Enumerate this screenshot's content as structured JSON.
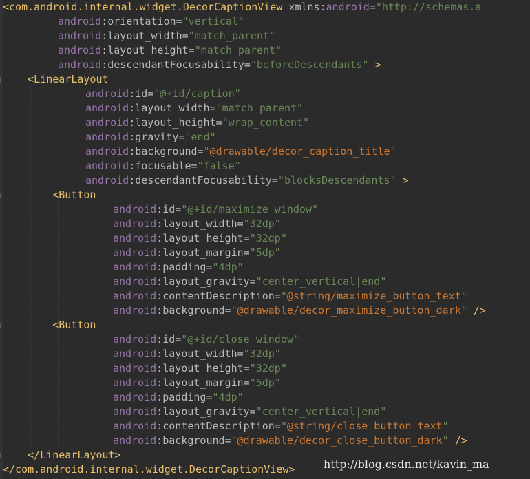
{
  "code_lines": [
    {
      "indent": 0,
      "parts": [
        {
          "t": "<com.android.internal.widget.DecorCaptionView",
          "c": "tag"
        },
        {
          "t": " ",
          "c": "plain"
        },
        {
          "t": "xmlns",
          "c": "attr"
        },
        {
          "t": ":",
          "c": "plain"
        },
        {
          "t": "android",
          "c": "ns"
        },
        {
          "t": "=",
          "c": "plain"
        },
        {
          "t": "\"http://schemas.a",
          "c": "str"
        }
      ]
    },
    {
      "indent": 1,
      "parts": [
        {
          "t": "android",
          "c": "ns"
        },
        {
          "t": ":orientation=",
          "c": "attr"
        },
        {
          "t": "\"vertical\"",
          "c": "str"
        }
      ]
    },
    {
      "indent": 1,
      "parts": [
        {
          "t": "android",
          "c": "ns"
        },
        {
          "t": ":layout_width=",
          "c": "attr"
        },
        {
          "t": "\"match_parent\"",
          "c": "str"
        }
      ]
    },
    {
      "indent": 1,
      "parts": [
        {
          "t": "android",
          "c": "ns"
        },
        {
          "t": ":layout_height=",
          "c": "attr"
        },
        {
          "t": "\"match_parent\"",
          "c": "str"
        }
      ]
    },
    {
      "indent": 1,
      "parts": [
        {
          "t": "android",
          "c": "ns"
        },
        {
          "t": ":descendantFocusability=",
          "c": "attr"
        },
        {
          "t": "\"beforeDescendants\"",
          "c": "str"
        },
        {
          "t": " >",
          "c": "tag"
        }
      ]
    },
    {
      "indent": 0,
      "parts": [
        {
          "t": "    <LinearLayout",
          "c": "tag"
        }
      ]
    },
    {
      "indent": 2,
      "parts": [
        {
          "t": "android",
          "c": "ns"
        },
        {
          "t": ":id=",
          "c": "attr"
        },
        {
          "t": "\"@+id/caption\"",
          "c": "str"
        }
      ]
    },
    {
      "indent": 2,
      "parts": [
        {
          "t": "android",
          "c": "ns"
        },
        {
          "t": ":layout_width=",
          "c": "attr"
        },
        {
          "t": "\"match_parent\"",
          "c": "str"
        }
      ]
    },
    {
      "indent": 2,
      "parts": [
        {
          "t": "android",
          "c": "ns"
        },
        {
          "t": ":layout_height=",
          "c": "attr"
        },
        {
          "t": "\"wrap_content\"",
          "c": "str"
        }
      ]
    },
    {
      "indent": 2,
      "parts": [
        {
          "t": "android",
          "c": "ns"
        },
        {
          "t": ":gravity=",
          "c": "attr"
        },
        {
          "t": "\"end\"",
          "c": "str"
        }
      ]
    },
    {
      "indent": 2,
      "parts": [
        {
          "t": "android",
          "c": "ns"
        },
        {
          "t": ":background=",
          "c": "attr"
        },
        {
          "t": "\"",
          "c": "str"
        },
        {
          "t": "@drawable/decor_caption_title",
          "c": "res"
        },
        {
          "t": "\"",
          "c": "str"
        }
      ]
    },
    {
      "indent": 2,
      "parts": [
        {
          "t": "android",
          "c": "ns"
        },
        {
          "t": ":focusable=",
          "c": "attr"
        },
        {
          "t": "\"false\"",
          "c": "str"
        }
      ]
    },
    {
      "indent": 2,
      "parts": [
        {
          "t": "android",
          "c": "ns"
        },
        {
          "t": ":descendantFocusability=",
          "c": "attr"
        },
        {
          "t": "\"blocksDescendants\"",
          "c": "str"
        },
        {
          "t": " >",
          "c": "tag"
        }
      ]
    },
    {
      "indent": 0,
      "parts": [
        {
          "t": "        <Button",
          "c": "tag"
        }
      ]
    },
    {
      "indent": 3,
      "parts": [
        {
          "t": "android",
          "c": "ns"
        },
        {
          "t": ":id=",
          "c": "attr"
        },
        {
          "t": "\"@+id/maximize_window\"",
          "c": "str"
        }
      ]
    },
    {
      "indent": 3,
      "parts": [
        {
          "t": "android",
          "c": "ns"
        },
        {
          "t": ":layout_width=",
          "c": "attr"
        },
        {
          "t": "\"32dp\"",
          "c": "str"
        }
      ]
    },
    {
      "indent": 3,
      "parts": [
        {
          "t": "android",
          "c": "ns"
        },
        {
          "t": ":layout_height=",
          "c": "attr"
        },
        {
          "t": "\"32dp\"",
          "c": "str"
        }
      ]
    },
    {
      "indent": 3,
      "parts": [
        {
          "t": "android",
          "c": "ns"
        },
        {
          "t": ":layout_margin=",
          "c": "attr"
        },
        {
          "t": "\"5dp\"",
          "c": "str"
        }
      ]
    },
    {
      "indent": 3,
      "parts": [
        {
          "t": "android",
          "c": "ns"
        },
        {
          "t": ":padding=",
          "c": "attr"
        },
        {
          "t": "\"4dp\"",
          "c": "str"
        }
      ]
    },
    {
      "indent": 3,
      "parts": [
        {
          "t": "android",
          "c": "ns"
        },
        {
          "t": ":layout_gravity=",
          "c": "attr"
        },
        {
          "t": "\"center_vertical|end\"",
          "c": "str"
        }
      ]
    },
    {
      "indent": 3,
      "parts": [
        {
          "t": "android",
          "c": "ns"
        },
        {
          "t": ":contentDescription=",
          "c": "attr"
        },
        {
          "t": "\"",
          "c": "str"
        },
        {
          "t": "@string/maximize_button_text",
          "c": "res"
        },
        {
          "t": "\"",
          "c": "str"
        }
      ]
    },
    {
      "indent": 3,
      "parts": [
        {
          "t": "android",
          "c": "ns"
        },
        {
          "t": ":background=",
          "c": "attr"
        },
        {
          "t": "\"",
          "c": "str"
        },
        {
          "t": "@drawable/decor_maximize_button_dark",
          "c": "res"
        },
        {
          "t": "\"",
          "c": "str"
        },
        {
          "t": " />",
          "c": "tag"
        }
      ]
    },
    {
      "indent": 0,
      "parts": [
        {
          "t": "        <Button",
          "c": "tag"
        }
      ]
    },
    {
      "indent": 3,
      "parts": [
        {
          "t": "android",
          "c": "ns"
        },
        {
          "t": ":id=",
          "c": "attr"
        },
        {
          "t": "\"@+id/close_window\"",
          "c": "str"
        }
      ]
    },
    {
      "indent": 3,
      "parts": [
        {
          "t": "android",
          "c": "ns"
        },
        {
          "t": ":layout_width=",
          "c": "attr"
        },
        {
          "t": "\"32dp\"",
          "c": "str"
        }
      ]
    },
    {
      "indent": 3,
      "parts": [
        {
          "t": "android",
          "c": "ns"
        },
        {
          "t": ":layout_height=",
          "c": "attr"
        },
        {
          "t": "\"32dp\"",
          "c": "str"
        }
      ]
    },
    {
      "indent": 3,
      "parts": [
        {
          "t": "android",
          "c": "ns"
        },
        {
          "t": ":layout_margin=",
          "c": "attr"
        },
        {
          "t": "\"5dp\"",
          "c": "str"
        }
      ]
    },
    {
      "indent": 3,
      "parts": [
        {
          "t": "android",
          "c": "ns"
        },
        {
          "t": ":padding=",
          "c": "attr"
        },
        {
          "t": "\"4dp\"",
          "c": "str"
        }
      ]
    },
    {
      "indent": 3,
      "parts": [
        {
          "t": "android",
          "c": "ns"
        },
        {
          "t": ":layout_gravity=",
          "c": "attr"
        },
        {
          "t": "\"center_vertical|end\"",
          "c": "str"
        }
      ]
    },
    {
      "indent": 3,
      "parts": [
        {
          "t": "android",
          "c": "ns"
        },
        {
          "t": ":contentDescription=",
          "c": "attr"
        },
        {
          "t": "\"",
          "c": "str"
        },
        {
          "t": "@string/close_button_text",
          "c": "res"
        },
        {
          "t": "\"",
          "c": "str"
        }
      ]
    },
    {
      "indent": 3,
      "parts": [
        {
          "t": "android",
          "c": "ns"
        },
        {
          "t": ":background=",
          "c": "attr"
        },
        {
          "t": "\"",
          "c": "str"
        },
        {
          "t": "@drawable/decor_close_button_dark",
          "c": "res"
        },
        {
          "t": "\"",
          "c": "str"
        },
        {
          "t": " />",
          "c": "tag"
        }
      ]
    },
    {
      "indent": 0,
      "parts": [
        {
          "t": "    </LinearLayout>",
          "c": "tag"
        }
      ]
    },
    {
      "indent": 0,
      "parts": [
        {
          "t": "</com.android.internal.widget.DecorCaptionView>",
          "c": "tag"
        }
      ]
    }
  ],
  "watermark": "http://blog.csdn.net/kavin_ma",
  "colors": {
    "background": "#2b2b2b",
    "tag": "#e8bf6a",
    "namespace": "#9876aa",
    "attribute": "#bababa",
    "string": "#6a8759",
    "resource": "#cc7832"
  }
}
